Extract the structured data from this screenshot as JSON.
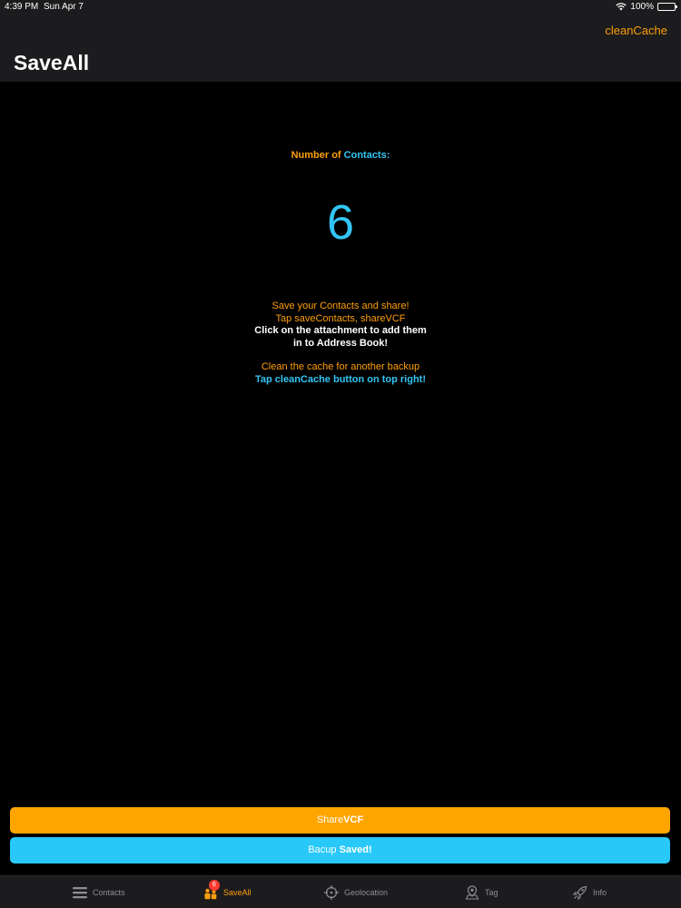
{
  "status_bar": {
    "time": "4:39 PM",
    "date": "Sun Apr 7",
    "battery": "100%"
  },
  "nav": {
    "title": "SaveAll",
    "right_button": "cleanCache"
  },
  "main": {
    "count_label_prefix": "Number of",
    "count_label_suffix": "Contacts:",
    "count": "6",
    "instructions": {
      "line1": "Save your Contacts and share!",
      "line2": "Tap saveContacts, shareVCF",
      "line3": "Click on the attachment to add them",
      "line4": "in to Address Book!",
      "line5": "Clean the cache for another backup",
      "line6": "Tap cleanCache button on top right!"
    }
  },
  "buttons": {
    "share_prefix": "Share",
    "share_bold": "VCF",
    "backup_prefix": "Bacup",
    "backup_bold": "Saved!"
  },
  "tabs": [
    {
      "label": "Contacts",
      "icon": "list-icon"
    },
    {
      "label": "SaveAll",
      "icon": "people-icon",
      "badge": "6",
      "active": true
    },
    {
      "label": "Geolocation",
      "icon": "crosshair-icon"
    },
    {
      "label": "Tag",
      "icon": "map-pin-icon"
    },
    {
      "label": "Info",
      "icon": "rocket-icon"
    }
  ],
  "colors": {
    "accent_orange": "#ff9f0a",
    "accent_blue": "#32c5f4",
    "share_button": "#ffa500",
    "backup_button": "#28c8f8"
  }
}
